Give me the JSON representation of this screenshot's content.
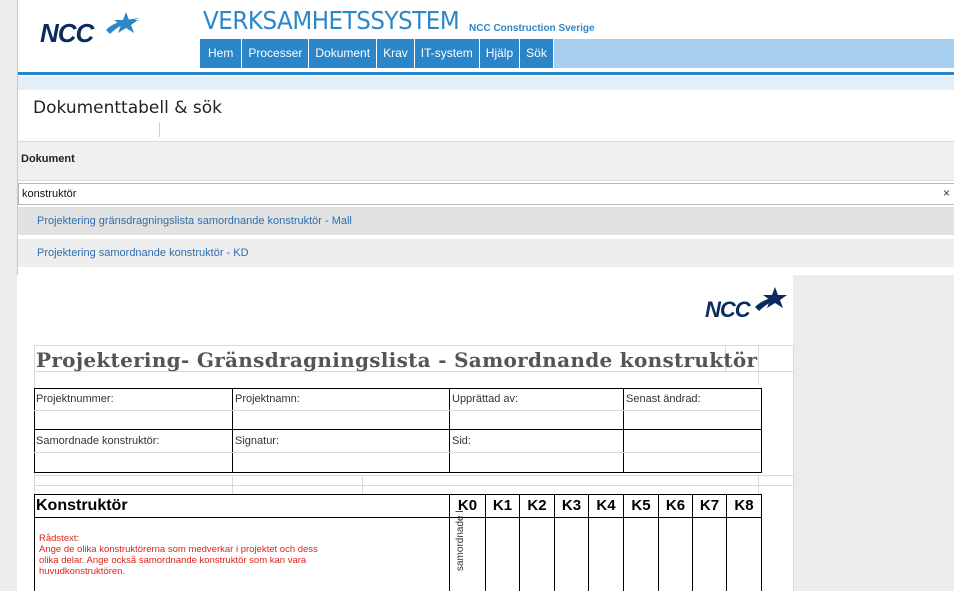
{
  "header": {
    "logo_text": "NCC",
    "system_title": "VERKSAMHETSSYSTEM",
    "system_subtitle": "NCC Construction Sverige",
    "nav": [
      "Hem",
      "Processer",
      "Dokument",
      "Krav",
      "IT-system",
      "Hjälp",
      "Sök"
    ]
  },
  "main": {
    "page_title": "Dokumenttabell & sök",
    "section_label": "Dokument",
    "search": {
      "value": "konstruktör",
      "clear_symbol": "×"
    },
    "results": [
      "Projektering gränsdragningslista samordnande konstruktör - Mall",
      "Projektering samordnande konstruktör - KD"
    ]
  },
  "document": {
    "logo_text": "NCC",
    "title": "Projektering- Gränsdragningslista - Samordnande konstruktör",
    "fields": {
      "projektnummer": "Projektnummer:",
      "projektnamn": "Projektnamn:",
      "upprattad_av": "Upprättad av:",
      "senast_andrad": "Senast ändrad:",
      "samordnade": "Samordnade konstruktör:",
      "signatur": "Signatur:",
      "sid": "Sid:"
    },
    "konstruktor_label": "Konstruktör",
    "k_columns": [
      "K0",
      "K1",
      "K2",
      "K3",
      "K4",
      "K5",
      "K6",
      "K7",
      "K8"
    ],
    "advice": {
      "heading": "Rådstext:",
      "lines": [
        "Ange de olika konstruktörerna som medverkar i projektet och dess",
        "olika delar. Ange också samordnande  konstruktör som kan vara",
        "huvudkonstruktören."
      ]
    },
    "vertical_label": "samordnade k"
  },
  "colors": {
    "brand_blue": "#2a86c9",
    "nav_bg": "#a9cfee",
    "link": "#2d6fb2",
    "advice_red": "#e0221b",
    "logo_navy": "#0b2a5e"
  }
}
